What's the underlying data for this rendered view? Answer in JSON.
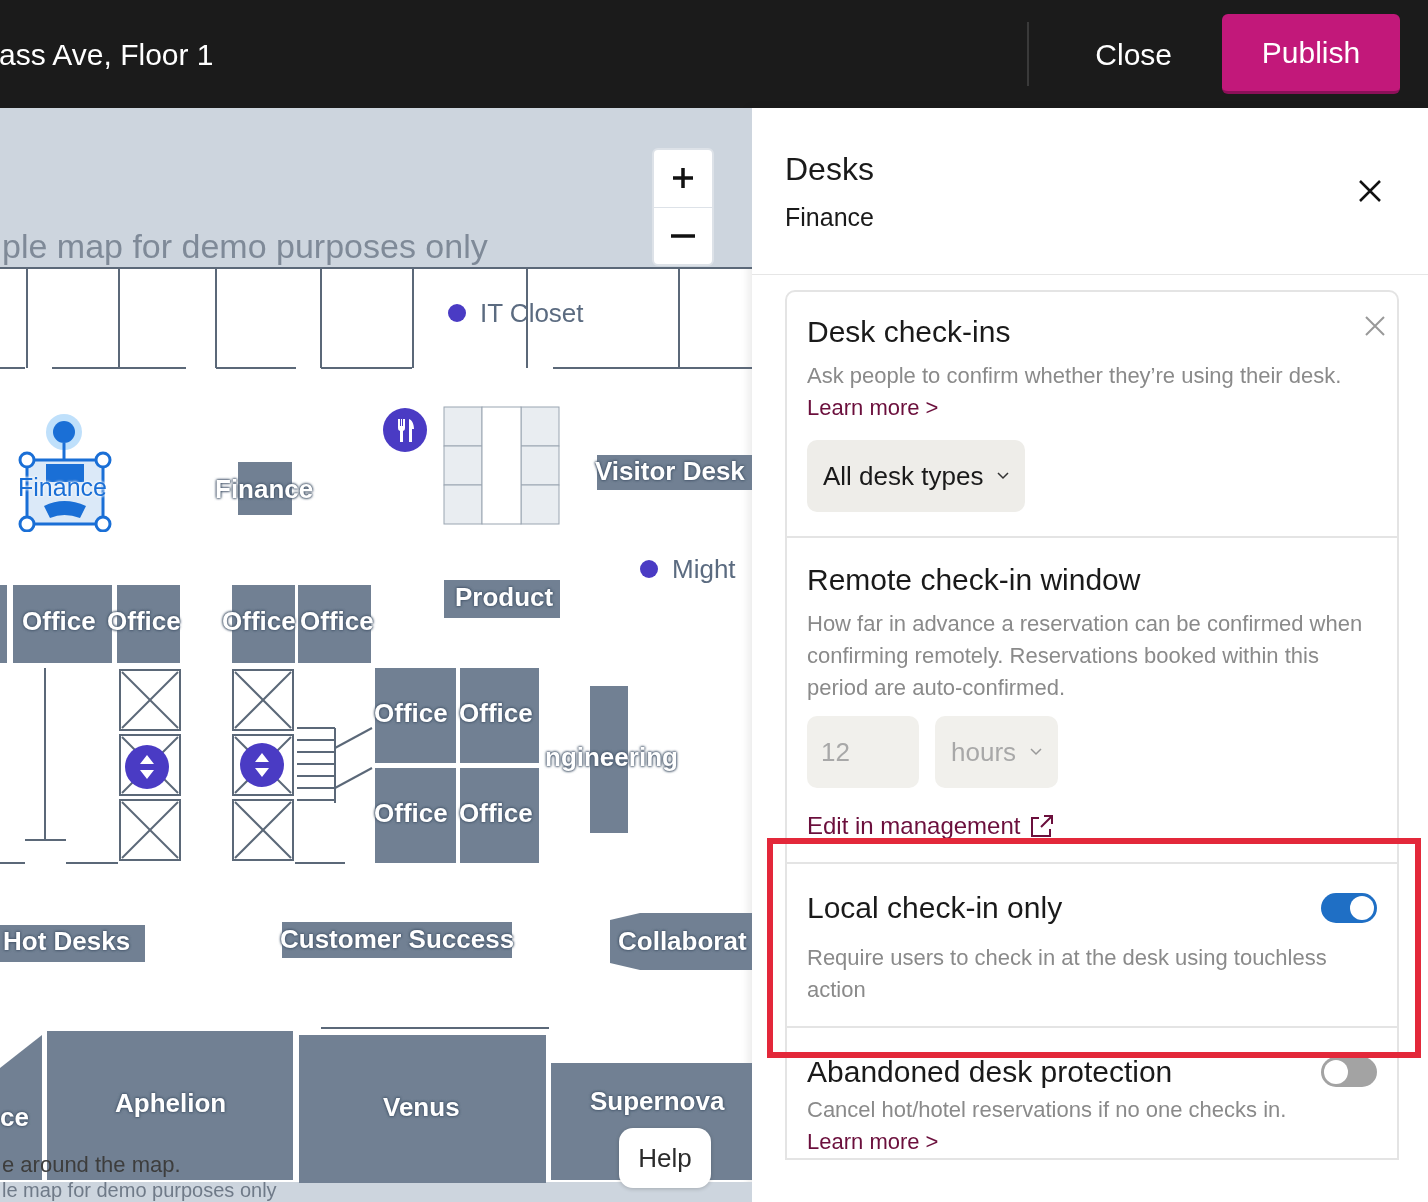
{
  "header": {
    "title": "ass Ave, Floor 1",
    "close": "Close",
    "publish": "Publish"
  },
  "map": {
    "watermark_top": "ple map for demo purposes only",
    "hint": "e around the map.",
    "watermark_bottom": "le map for demo purposes only",
    "help": "Help",
    "labels": [
      {
        "kind": "poi",
        "text": "IT Closet"
      },
      {
        "kind": "selected",
        "text": "Finance"
      },
      {
        "kind": "zone",
        "text": "Finance"
      },
      {
        "kind": "zone",
        "text": "Visitor Desk"
      },
      {
        "kind": "poi",
        "text": "Might"
      },
      {
        "kind": "zone",
        "text": "Product"
      },
      {
        "kind": "zone",
        "text": "Office"
      },
      {
        "kind": "zone",
        "text": "Office"
      },
      {
        "kind": "zone",
        "text": "Office"
      },
      {
        "kind": "zone",
        "text": "Office"
      },
      {
        "kind": "zone",
        "text": "Office"
      },
      {
        "kind": "zone",
        "text": "Office"
      },
      {
        "kind": "zone",
        "text": "Office"
      },
      {
        "kind": "zone",
        "text": "Office"
      },
      {
        "kind": "zone",
        "text": "ngineering"
      },
      {
        "kind": "zone",
        "text": "Hot Desks"
      },
      {
        "kind": "zone",
        "text": "Customer Success"
      },
      {
        "kind": "zone",
        "text": "Collaborat"
      },
      {
        "kind": "zone",
        "text": "ce"
      },
      {
        "kind": "zone",
        "text": "Aphelion"
      },
      {
        "kind": "zone",
        "text": "Venus"
      },
      {
        "kind": "zone",
        "text": "Supernova"
      }
    ]
  },
  "panel": {
    "title": "Desks",
    "subtitle": "Finance",
    "checkins": {
      "title": "Desk check-ins",
      "description": "Ask people to confirm whether they’re using their desk.",
      "link": "Learn more >",
      "dropdown": "All desk types"
    },
    "remote": {
      "title": "Remote check-in window",
      "description": "How far in advance a reservation can be confirmed when confirming remotely. Reservations booked within this period are auto-confirmed.",
      "amount": {
        "value": "12",
        "disabled": true
      },
      "unit": {
        "value": "hours",
        "disabled": true
      },
      "link": "Edit in management"
    },
    "local": {
      "title": "Local check-in only",
      "on": true,
      "highlighted": true,
      "description": "Require users to check in at the desk using touchless action"
    },
    "abandoned": {
      "title": "Abandoned desk protection",
      "on": false,
      "description": "Cancel hot/hotel reservations if no one checks in.",
      "link": "Learn more >"
    }
  }
}
